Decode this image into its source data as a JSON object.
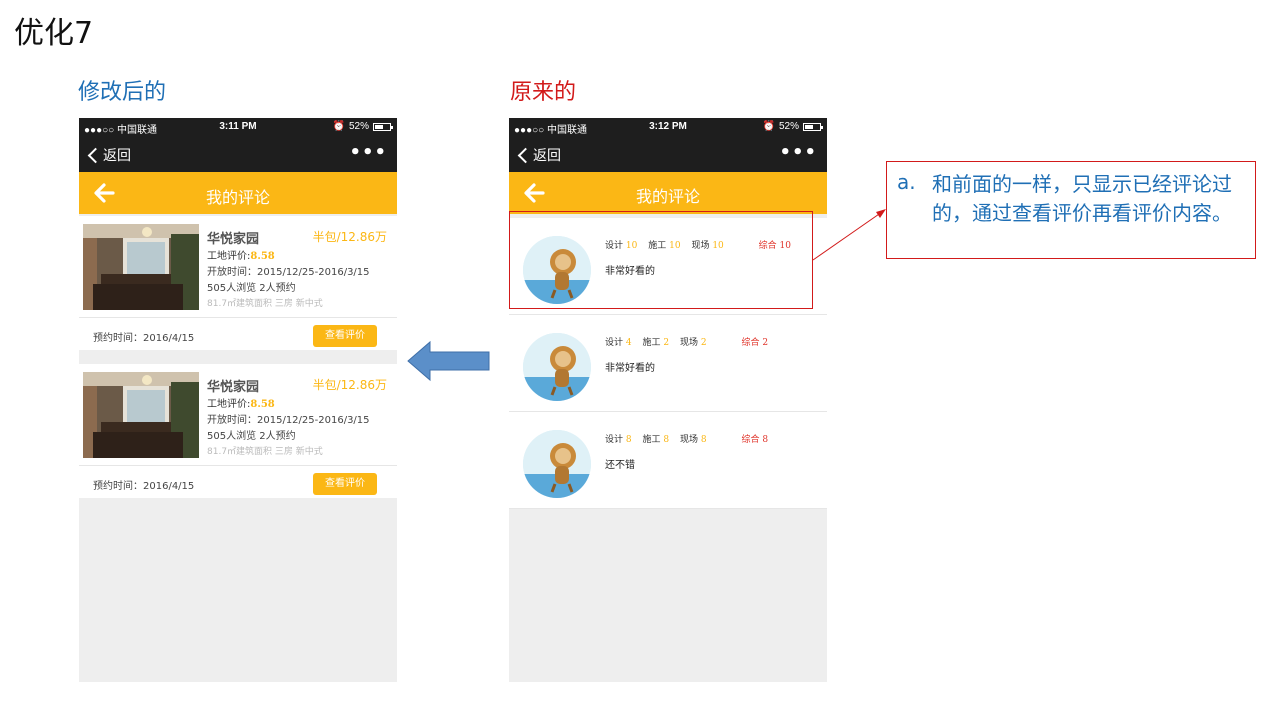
{
  "slide_title": "优化7",
  "label_after": "修改后的",
  "label_before": "原来的",
  "phone_after": {
    "status": {
      "carrier": "●●●○○ 中国联通",
      "time": "3:11 PM",
      "battery": "52%",
      "battery_fraction": 0.52
    },
    "nav": {
      "back_label": "返回",
      "more_label": "•••"
    },
    "header_title": "我的评论",
    "cards": [
      {
        "name": "华悦家园",
        "price": "半包/12.86万",
        "rating_label": "工地评价:",
        "rating_value": "8.58",
        "open_time": "开放时间：2015/12/25-2016/3/15",
        "stats": "505人浏览   2人预约",
        "tags": "81.7㎡建筑面积   三房   新中式",
        "appoint_time": "预约时间：2016/4/15",
        "button_label": "查看评价"
      },
      {
        "name": "华悦家园",
        "price": "半包/12.86万",
        "rating_label": "工地评价:",
        "rating_value": "8.58",
        "open_time": "开放时间：2015/12/25-2016/3/15",
        "stats": "505人浏览   2人预约",
        "tags": "81.7㎡建筑面积   三房   新中式",
        "appoint_time": "预约时间：2016/4/15",
        "button_label": "查看评价"
      }
    ]
  },
  "phone_before": {
    "status": {
      "carrier": "●●●○○ 中国联通",
      "time": "3:12 PM",
      "battery": "52%",
      "battery_fraction": 0.52
    },
    "nav": {
      "back_label": "返回",
      "more_label": "•••"
    },
    "header_title": "我的评论",
    "comments": [
      {
        "design_label": "设计",
        "design": "10",
        "build_label": "施工",
        "build": "10",
        "site_label": "现场",
        "site": "10",
        "total_label": "综合",
        "total": "10",
        "text": "非常好看的"
      },
      {
        "design_label": "设计",
        "design": "4",
        "build_label": "施工",
        "build": "2",
        "site_label": "现场",
        "site": "2",
        "total_label": "综合",
        "total": "2",
        "text": "非常好看的"
      },
      {
        "design_label": "设计",
        "design": "8",
        "build_label": "施工",
        "build": "8",
        "site_label": "现场",
        "site": "8",
        "total_label": "综合",
        "total": "8",
        "text": "还不错"
      }
    ]
  },
  "note": {
    "marker": "a.",
    "text": "和前面的一样，只显示已经评论过的，通过查看评价再看评价内容。"
  },
  "colors": {
    "accent": "#fbb715",
    "after_title": "#1f6fb5",
    "before_title": "#d21a1a",
    "arrow": "#5b8fc9"
  }
}
